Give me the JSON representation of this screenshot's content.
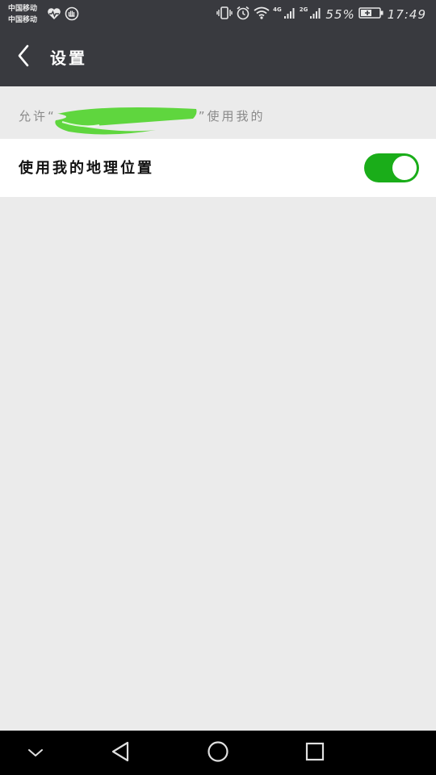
{
  "status_bar": {
    "carrier_1": "中国移动",
    "carrier_2": "中国移动",
    "network_1": "4G",
    "network_2": "2G",
    "battery_percent": "55%",
    "time": "17:49"
  },
  "header": {
    "title": "设置"
  },
  "permission": {
    "header_prefix": "允许“",
    "header_suffix": "”使用我的",
    "location_label": "使用我的地理位置",
    "location_enabled": true
  },
  "colors": {
    "bar_background": "#393a3f",
    "toggle_on": "#1aad19",
    "redaction": "#5fd63e",
    "page_background": "#ebebeb"
  },
  "icons": {
    "status_left": [
      "heart-rate-icon",
      "glove-icon"
    ],
    "status_right": [
      "vibrate-icon",
      "alarm-icon",
      "wifi-icon",
      "signal-icon",
      "signal-icon",
      "battery-icon"
    ],
    "nav": [
      "collapse-icon",
      "back-icon",
      "home-icon",
      "recents-icon"
    ]
  }
}
